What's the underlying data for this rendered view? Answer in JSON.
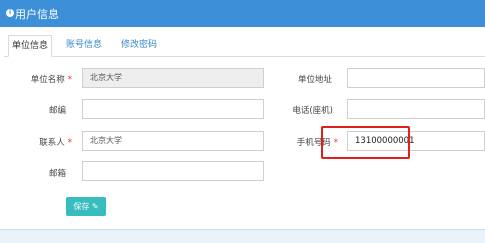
{
  "header": {
    "title": "用户信息",
    "icon": "info-icon"
  },
  "tabs": [
    {
      "label": "单位信息",
      "active": true
    },
    {
      "label": "账号信息",
      "active": false
    },
    {
      "label": "修改密码",
      "active": false
    }
  ],
  "form": {
    "unit_name": {
      "label": "单位名称",
      "required_mark": "*",
      "value": "北京大学"
    },
    "unit_address": {
      "label": "单位地址",
      "value": ""
    },
    "postcode": {
      "label": "邮编",
      "value": ""
    },
    "telephone": {
      "label": "电话(座机)",
      "value": ""
    },
    "contact": {
      "label": "联系人",
      "required_mark": "*",
      "value": "北京大学"
    },
    "mobile": {
      "label": "手机号码",
      "required_mark": "*",
      "value": "13100000001"
    },
    "email": {
      "label": "邮箱",
      "value": ""
    }
  },
  "save_button": {
    "label": "保存",
    "icon": "edit-icon"
  },
  "colors": {
    "header": "#3d8fd8",
    "save_button": "#37bcbf",
    "highlight": "#e0201b"
  }
}
